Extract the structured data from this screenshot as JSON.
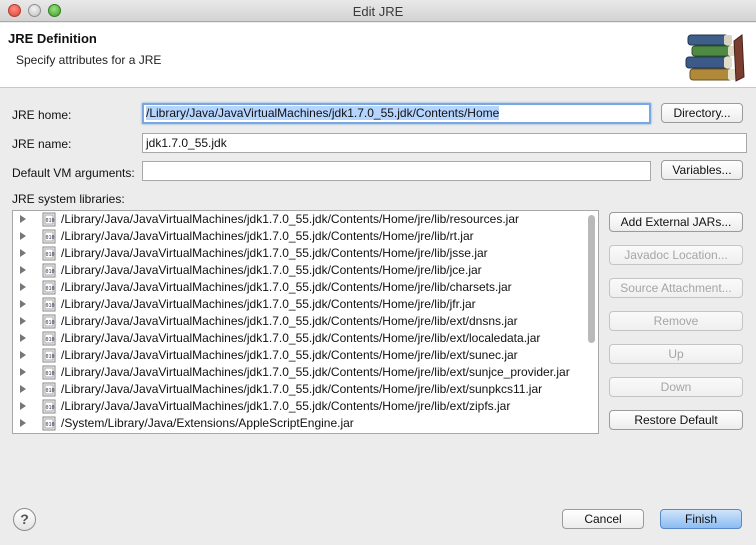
{
  "window": {
    "title": "Edit JRE"
  },
  "header": {
    "title": "JRE Definition",
    "subtitle": "Specify attributes for a JRE",
    "icon": "books-icon"
  },
  "form": {
    "jre_home_label": "JRE home:",
    "jre_home_value": "/Library/Java/JavaVirtualMachines/jdk1.7.0_55.jdk/Contents/Home",
    "directory_button": "Directory...",
    "jre_name_label": "JRE name:",
    "jre_name_value": "jdk1.7.0_55.jdk",
    "vm_args_label": "Default VM arguments:",
    "vm_args_value": "",
    "variables_button": "Variables...",
    "libraries_label": "JRE system libraries:"
  },
  "libraries": [
    "/Library/Java/JavaVirtualMachines/jdk1.7.0_55.jdk/Contents/Home/jre/lib/resources.jar",
    "/Library/Java/JavaVirtualMachines/jdk1.7.0_55.jdk/Contents/Home/jre/lib/rt.jar",
    "/Library/Java/JavaVirtualMachines/jdk1.7.0_55.jdk/Contents/Home/jre/lib/jsse.jar",
    "/Library/Java/JavaVirtualMachines/jdk1.7.0_55.jdk/Contents/Home/jre/lib/jce.jar",
    "/Library/Java/JavaVirtualMachines/jdk1.7.0_55.jdk/Contents/Home/jre/lib/charsets.jar",
    "/Library/Java/JavaVirtualMachines/jdk1.7.0_55.jdk/Contents/Home/jre/lib/jfr.jar",
    "/Library/Java/JavaVirtualMachines/jdk1.7.0_55.jdk/Contents/Home/jre/lib/ext/dnsns.jar",
    "/Library/Java/JavaVirtualMachines/jdk1.7.0_55.jdk/Contents/Home/jre/lib/ext/localedata.jar",
    "/Library/Java/JavaVirtualMachines/jdk1.7.0_55.jdk/Contents/Home/jre/lib/ext/sunec.jar",
    "/Library/Java/JavaVirtualMachines/jdk1.7.0_55.jdk/Contents/Home/jre/lib/ext/sunjce_provider.jar",
    "/Library/Java/JavaVirtualMachines/jdk1.7.0_55.jdk/Contents/Home/jre/lib/ext/sunpkcs11.jar",
    "/Library/Java/JavaVirtualMachines/jdk1.7.0_55.jdk/Contents/Home/jre/lib/ext/zipfs.jar",
    "/System/Library/Java/Extensions/AppleScriptEngine.jar"
  ],
  "side_buttons": {
    "add_external_jars": "Add External JARs...",
    "javadoc_location": "Javadoc Location...",
    "source_attachment": "Source Attachment...",
    "remove": "Remove",
    "up": "Up",
    "down": "Down",
    "restore_default": "Restore Default"
  },
  "footer": {
    "help": "?",
    "cancel": "Cancel",
    "finish": "Finish"
  },
  "icons": {
    "expand": "disclosure-triangle-icon",
    "jar": "jar-file-icon",
    "help": "help-icon"
  }
}
